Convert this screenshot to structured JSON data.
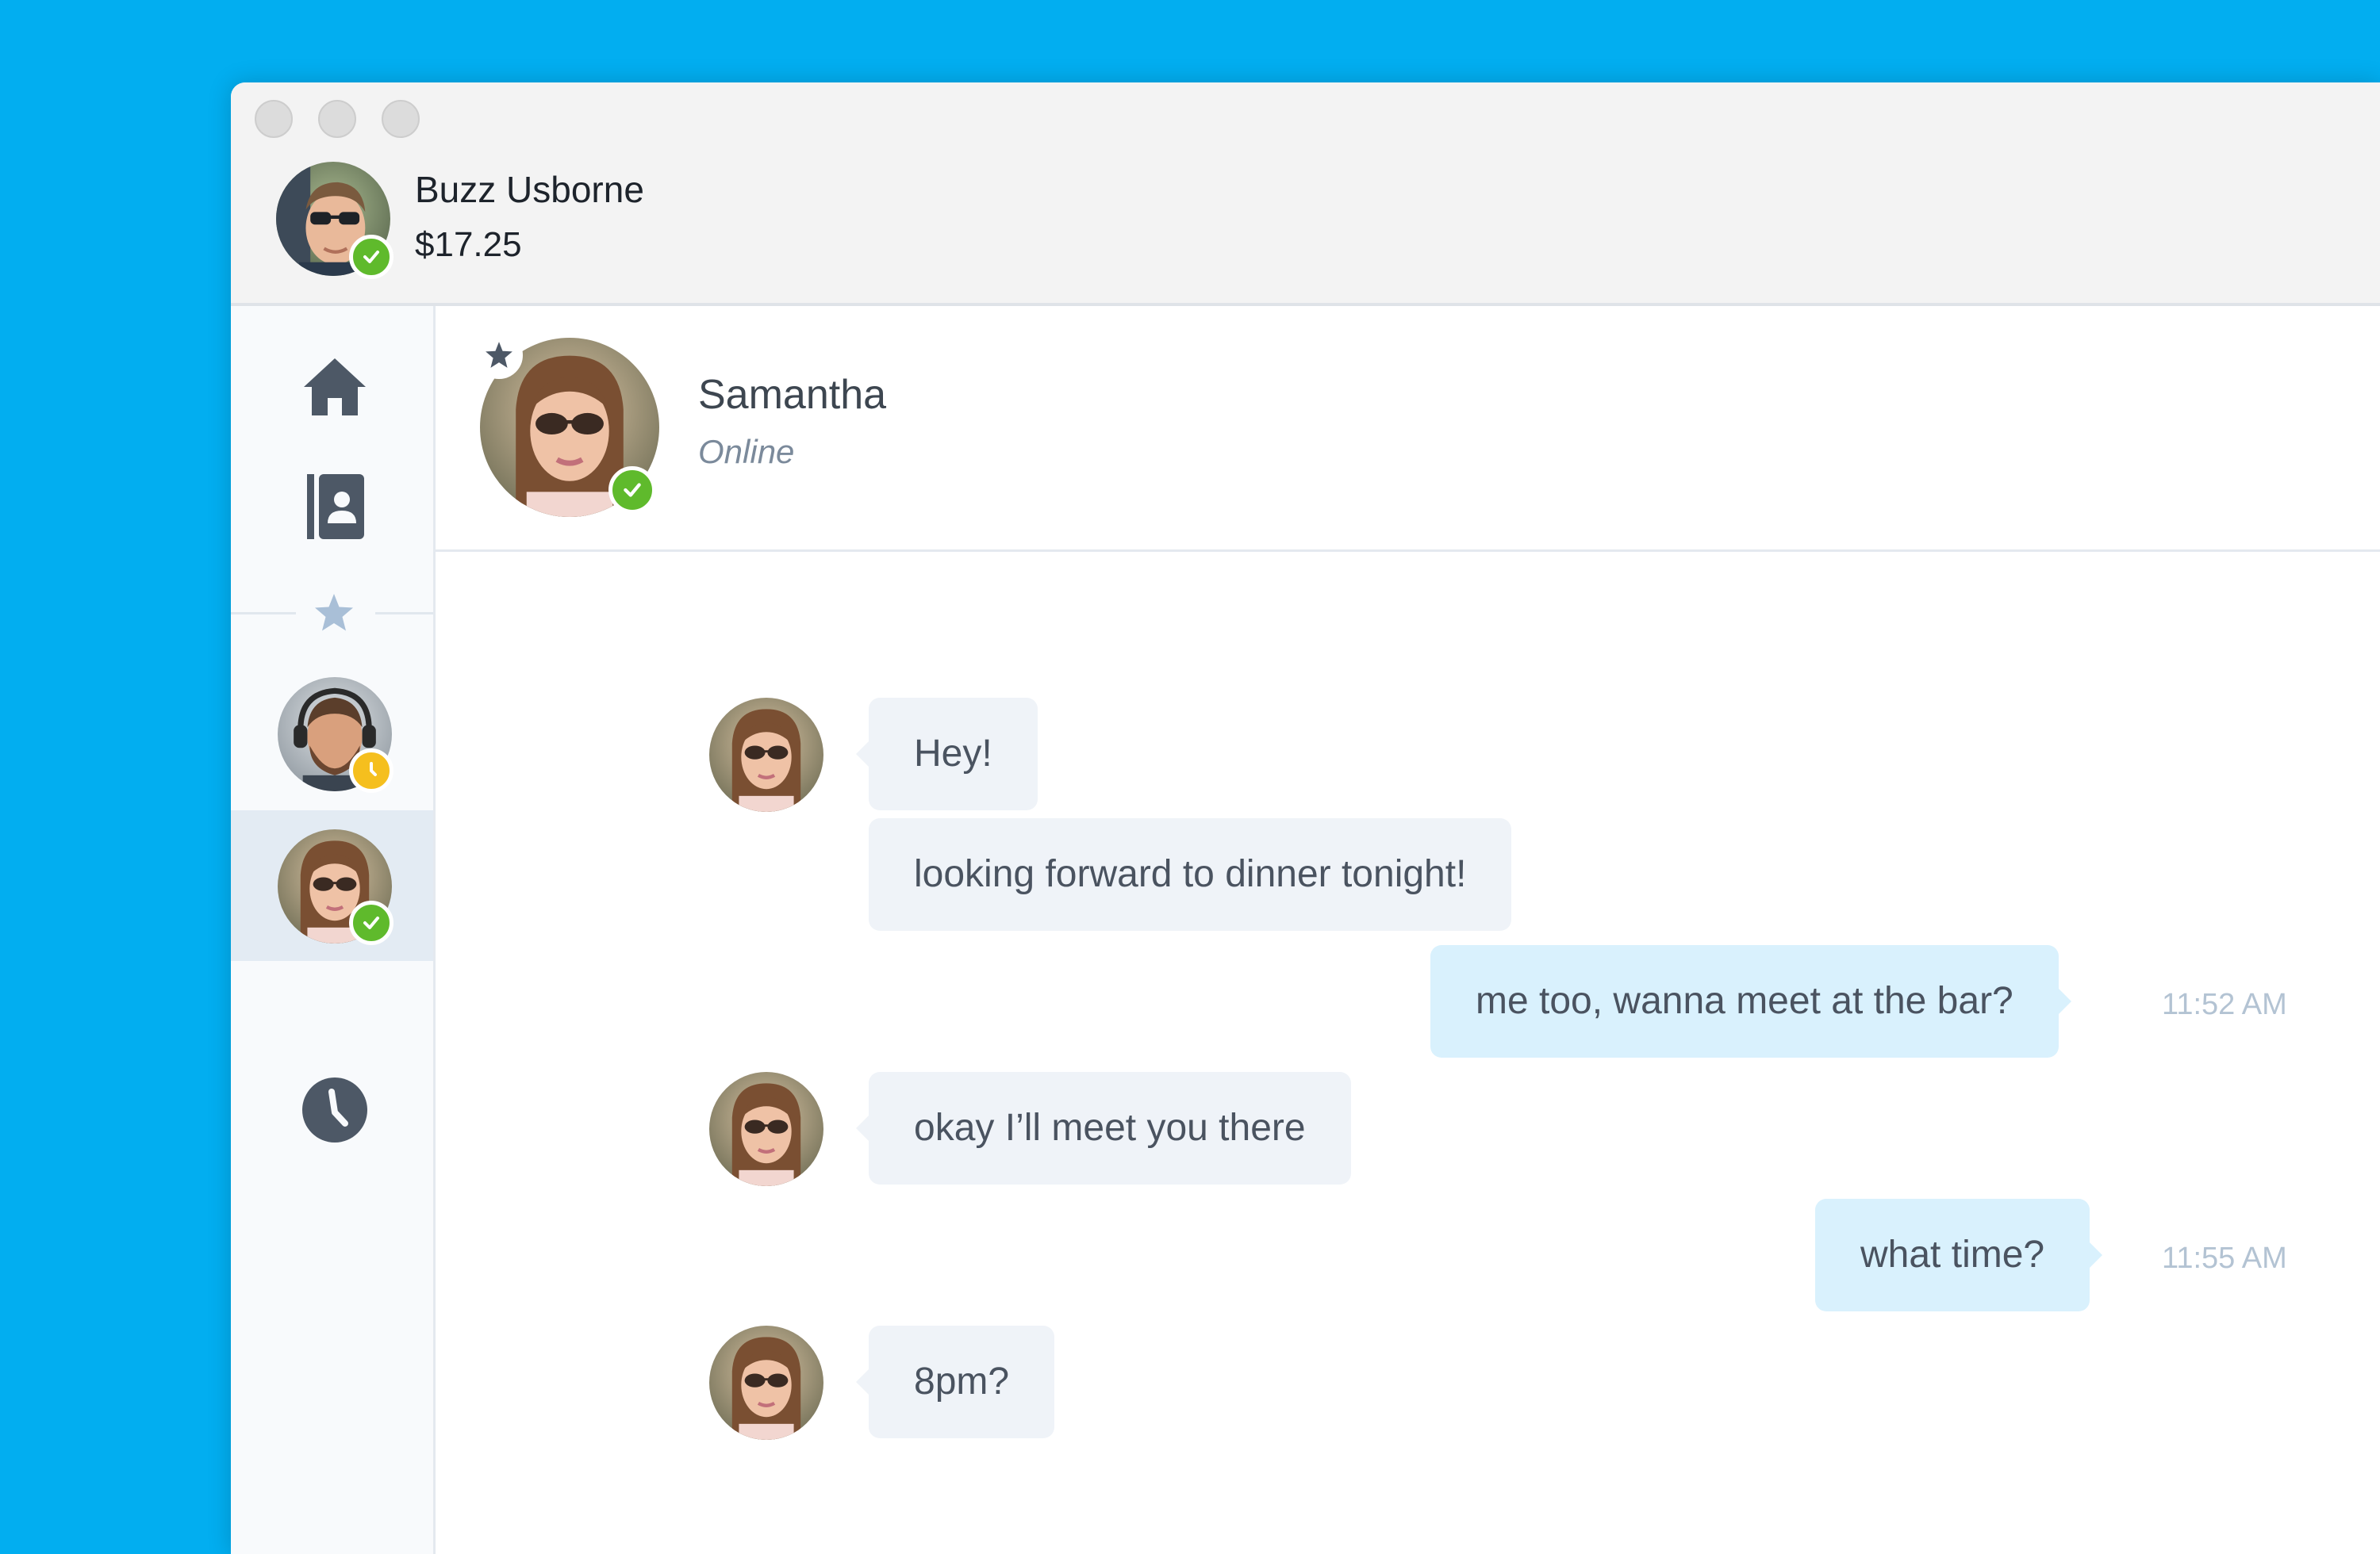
{
  "colors": {
    "desktop": "#02aef0",
    "online": "#5fba2c",
    "away": "#f5bf1e",
    "icon": "#4d5866",
    "favorites_star": "#a9bfd7",
    "incoming_bubble": "#eff3f8",
    "outgoing_bubble": "#d9f1fd"
  },
  "account": {
    "name": "Buzz Usborne",
    "balance": "$17.25",
    "status": "online",
    "avatar_icon": "user-avatar"
  },
  "sidebar": {
    "items": [
      {
        "icon": "home-icon",
        "label": "Home"
      },
      {
        "icon": "contacts-book-icon",
        "label": "Contacts"
      },
      {
        "icon": "star-icon",
        "label": "Favorites"
      },
      {
        "icon": "bearded-man-avatar",
        "status": "away"
      },
      {
        "icon": "samantha-avatar",
        "status": "online",
        "selected": true
      },
      {
        "icon": "clock-icon",
        "label": "Recent"
      }
    ]
  },
  "conversation": {
    "contact_name": "Samantha",
    "contact_status": "Online",
    "favorite": true,
    "messages": [
      {
        "from": "contact",
        "text": "Hey!"
      },
      {
        "from": "contact",
        "text": "looking forward to dinner tonight!"
      },
      {
        "from": "me",
        "text": "me too, wanna meet at the bar?",
        "time": "11:52 AM"
      },
      {
        "from": "contact",
        "text": "okay I’ll meet you there"
      },
      {
        "from": "me",
        "text": "what time?",
        "time": "11:55 AM"
      },
      {
        "from": "contact",
        "text": "8pm?"
      }
    ]
  }
}
